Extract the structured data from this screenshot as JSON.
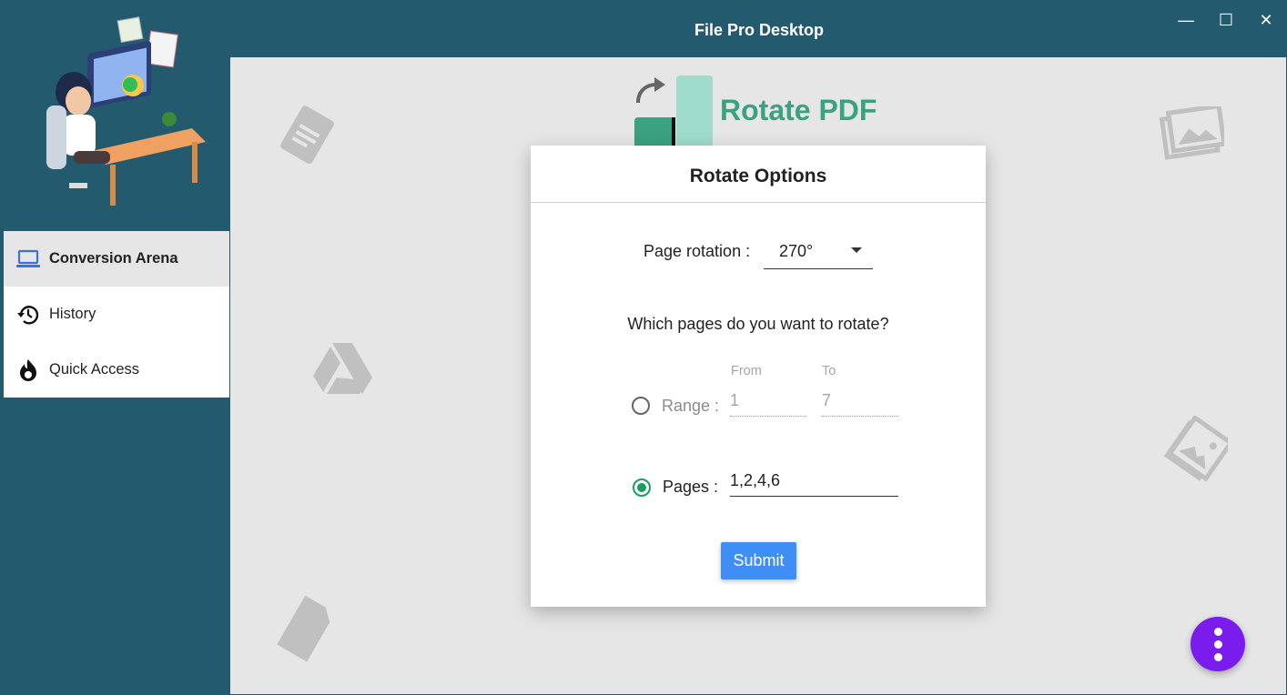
{
  "window": {
    "title": "File Pro Desktop",
    "controls": [
      "minimize",
      "maximize",
      "close"
    ],
    "minimize_glyph": "—",
    "maximize_glyph": "☐",
    "close_glyph": "✕"
  },
  "sidebar": {
    "items": [
      {
        "label": "Conversion Arena",
        "icon": "laptop-icon",
        "active": true
      },
      {
        "label": "History",
        "icon": "history-icon",
        "active": false
      },
      {
        "label": "Quick Access",
        "icon": "flame-icon",
        "active": false
      }
    ]
  },
  "header": {
    "title": "Rotate PDF"
  },
  "dialog": {
    "title": "Rotate Options",
    "page_rotation_label": "Page rotation :",
    "page_rotation_value": "270°",
    "question": "Which pages do you want to rotate?",
    "range": {
      "label": "Range :",
      "selected": false,
      "from_label": "From",
      "from_value": "1",
      "to_label": "To",
      "to_value": "7"
    },
    "pages": {
      "label": "Pages :",
      "selected": true,
      "value": "1,2,4,6"
    },
    "submit_label": "Submit"
  },
  "colors": {
    "sidebar_bg": "#245a6d",
    "main_bg": "#e6e6e6",
    "accent_green": "#3aa181",
    "radio_green": "#1a9e5e",
    "submit_blue": "#3f8ef5",
    "fab_purple": "#7b1cef"
  }
}
